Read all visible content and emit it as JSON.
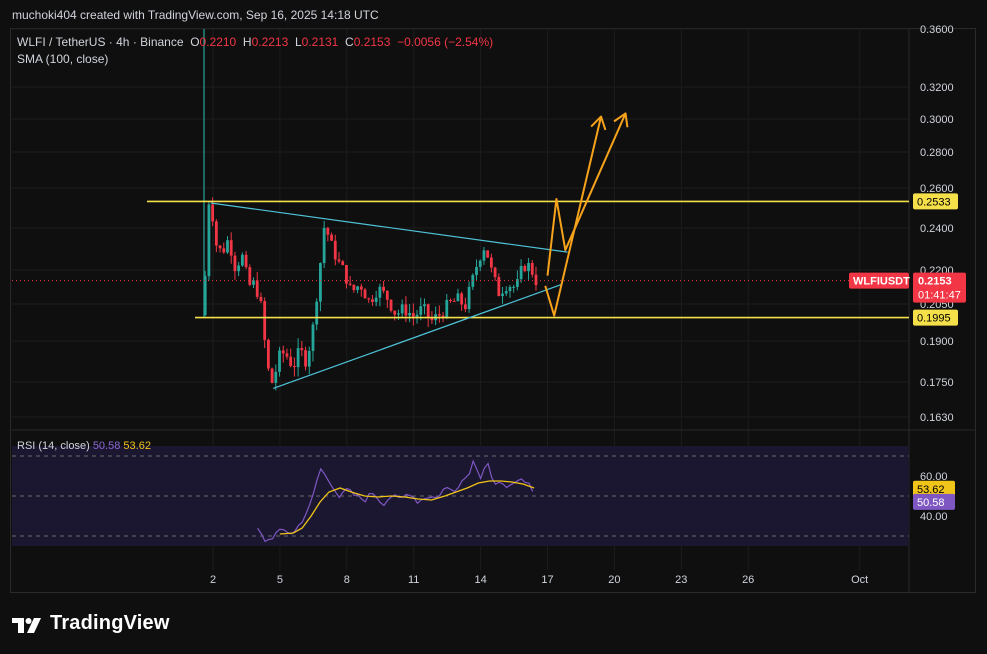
{
  "header": {
    "attribution": "muchoki404 created with TradingView.com, Sep 16, 2025 14:18 UTC"
  },
  "legend": {
    "symbol": "WLFI / TetherUS · 4h · Binance",
    "open_label": "O",
    "open": "0.2210",
    "high_label": "H",
    "high": "0.2213",
    "low_label": "L",
    "low": "0.2131",
    "close_label": "C",
    "close": "0.2153",
    "change": "−0.0056 (−2.54%)",
    "sma": "SMA (100, close)",
    "rsi_label": "RSI (14, close)",
    "rsi_value": "50.58",
    "rsi_ma_value": "53.62"
  },
  "colors": {
    "background": "#0f0f0f",
    "up": "#26a69a",
    "down": "#f23645",
    "level_line": "#f5e04a",
    "trend_line": "#4fc3d9",
    "projection": "#f7a21b",
    "rsi_line": "#7e57c2",
    "rsi_ma": "#f0c419",
    "rsi_band": "#1c1730",
    "price_badge": "#f23645"
  },
  "brand": {
    "name": "TradingView",
    "logo_icon": "tradingview-logo-icon"
  },
  "chart_data": {
    "type": "candlestick",
    "interval": "4h",
    "x_ticks": [
      "2",
      "5",
      "8",
      "11",
      "14",
      "17",
      "20",
      "23",
      "26",
      "Oct"
    ],
    "x_tick_days": [
      2,
      5,
      8,
      11,
      14,
      17,
      20,
      23,
      26,
      31
    ],
    "price_axis_labels": [
      "0.3600",
      "0.3200",
      "0.3000",
      "0.2800",
      "0.2600",
      "0.2400",
      "0.2200",
      "0.2050",
      "0.1900",
      "0.1750",
      "0.1630"
    ],
    "price_axis_values": [
      0.36,
      0.32,
      0.3,
      0.28,
      0.26,
      0.24,
      0.22,
      0.205,
      0.19,
      0.175,
      0.163
    ],
    "levels": [
      {
        "value": 0.2533,
        "label": "0.2533"
      },
      {
        "value": 0.1995,
        "label": "0.1995"
      }
    ],
    "current_price": {
      "symbol": "WLFIUSDT",
      "value": 0.2153,
      "label": "0.2153",
      "countdown": "01:41:47"
    },
    "trendlines": [
      {
        "name": "descending resistance",
        "from": {
          "day": 1.9,
          "price": 0.2525
        },
        "to": {
          "day": 17.9,
          "price": 0.2285
        }
      },
      {
        "name": "ascending support",
        "from": {
          "day": 4.7,
          "price": 0.1728
        },
        "to": {
          "day": 17.6,
          "price": 0.2135
        }
      }
    ],
    "projections": [
      [
        {
          "day": 16.9,
          "price": 0.213
        },
        {
          "day": 17.3,
          "price": 0.2003
        },
        {
          "day": 19.4,
          "price": 0.3015
        }
      ],
      [
        {
          "day": 17.0,
          "price": 0.2175
        },
        {
          "day": 17.4,
          "price": 0.2545
        },
        {
          "day": 17.8,
          "price": 0.2295
        },
        {
          "day": 20.5,
          "price": 0.3035
        }
      ]
    ],
    "price_anchors": [
      [
        1.6,
        0.2
      ],
      [
        1.75,
        0.252
      ],
      [
        1.9,
        0.255
      ],
      [
        2.1,
        0.233
      ],
      [
        2.4,
        0.228
      ],
      [
        2.7,
        0.235
      ],
      [
        3.0,
        0.221
      ],
      [
        3.3,
        0.227
      ],
      [
        3.6,
        0.213
      ],
      [
        3.9,
        0.214
      ],
      [
        4.15,
        0.204
      ],
      [
        4.35,
        0.187
      ],
      [
        4.5,
        0.178
      ],
      [
        4.7,
        0.174
      ],
      [
        4.9,
        0.183
      ],
      [
        5.2,
        0.186
      ],
      [
        5.6,
        0.181
      ],
      [
        5.9,
        0.186
      ],
      [
        6.2,
        0.183
      ],
      [
        6.5,
        0.196
      ],
      [
        6.8,
        0.222
      ],
      [
        7.0,
        0.242
      ],
      [
        7.3,
        0.232
      ],
      [
        7.6,
        0.224
      ],
      [
        7.9,
        0.219
      ],
      [
        8.2,
        0.21
      ],
      [
        8.6,
        0.214
      ],
      [
        9.0,
        0.206
      ],
      [
        9.4,
        0.212
      ],
      [
        9.8,
        0.208
      ],
      [
        10.2,
        0.201
      ],
      [
        10.6,
        0.203
      ],
      [
        11.0,
        0.2
      ],
      [
        11.4,
        0.203
      ],
      [
        11.8,
        0.198
      ],
      [
        12.2,
        0.201
      ],
      [
        12.6,
        0.205
      ],
      [
        13.0,
        0.207
      ],
      [
        13.3,
        0.204
      ],
      [
        13.6,
        0.214
      ],
      [
        13.9,
        0.225
      ],
      [
        14.2,
        0.232
      ],
      [
        14.5,
        0.219
      ],
      [
        14.8,
        0.21
      ],
      [
        15.2,
        0.214
      ],
      [
        15.6,
        0.212
      ],
      [
        15.9,
        0.222
      ],
      [
        16.2,
        0.222
      ],
      [
        16.5,
        0.215
      ]
    ],
    "rsi_axis_labels": [
      "60.00",
      "40.00"
    ],
    "rsi_axis_values": [
      60,
      40
    ],
    "rsi_ylim": [
      25,
      75
    ],
    "rsi_anchors": [
      [
        4.0,
        33
      ],
      [
        4.4,
        27
      ],
      [
        4.8,
        31
      ],
      [
        5.2,
        33
      ],
      [
        5.6,
        31
      ],
      [
        6.0,
        38
      ],
      [
        6.4,
        46
      ],
      [
        6.8,
        64
      ],
      [
        7.1,
        59
      ],
      [
        7.4,
        55
      ],
      [
        7.7,
        49
      ],
      [
        8.0,
        53
      ],
      [
        8.4,
        50
      ],
      [
        8.8,
        48
      ],
      [
        9.2,
        52
      ],
      [
        9.6,
        46
      ],
      [
        10.0,
        50
      ],
      [
        10.4,
        48
      ],
      [
        10.8,
        52
      ],
      [
        11.2,
        47
      ],
      [
        11.6,
        50
      ],
      [
        12.0,
        49
      ],
      [
        12.4,
        54
      ],
      [
        12.8,
        53
      ],
      [
        13.1,
        57
      ],
      [
        13.4,
        60
      ],
      [
        13.7,
        68
      ],
      [
        14.0,
        60
      ],
      [
        14.3,
        68
      ],
      [
        14.6,
        54
      ],
      [
        15.0,
        57
      ],
      [
        15.4,
        54
      ],
      [
        15.8,
        58
      ],
      [
        16.2,
        55
      ],
      [
        16.4,
        53
      ]
    ],
    "rsi_ma_anchors": [
      [
        5.0,
        31
      ],
      [
        5.6,
        31.5
      ],
      [
        6.0,
        34
      ],
      [
        6.4,
        40
      ],
      [
        6.8,
        47
      ],
      [
        7.2,
        52
      ],
      [
        7.7,
        54
      ],
      [
        8.2,
        52
      ],
      [
        8.8,
        50
      ],
      [
        9.4,
        49.5
      ],
      [
        10.0,
        50
      ],
      [
        10.6,
        49.5
      ],
      [
        11.2,
        48.5
      ],
      [
        11.8,
        48
      ],
      [
        12.4,
        50
      ],
      [
        12.9,
        52
      ],
      [
        13.4,
        54
      ],
      [
        13.9,
        56.5
      ],
      [
        14.4,
        57.5
      ],
      [
        14.9,
        57.5
      ],
      [
        15.4,
        57
      ],
      [
        15.9,
        56
      ],
      [
        16.4,
        54
      ]
    ]
  }
}
